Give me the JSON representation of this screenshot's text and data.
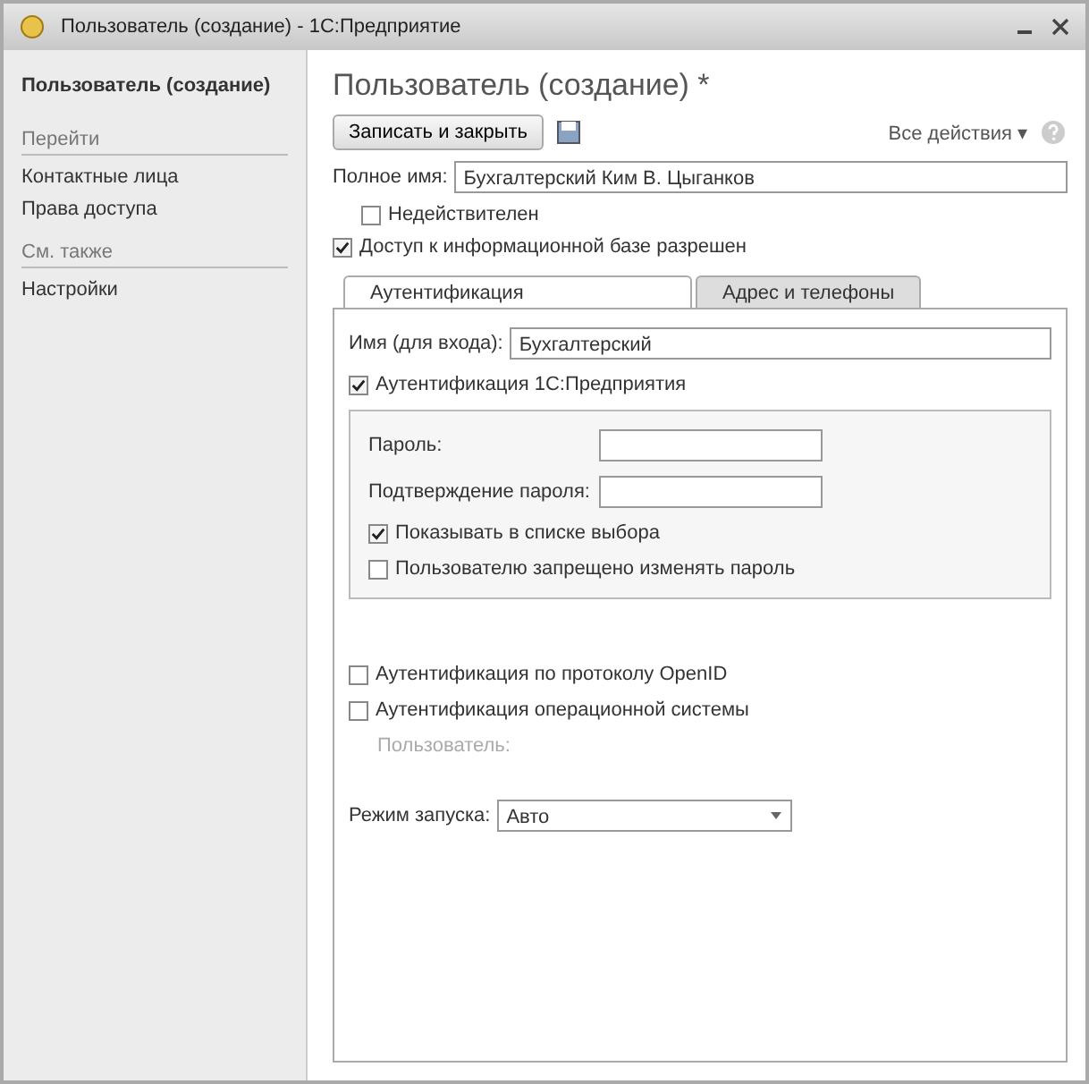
{
  "window": {
    "title": "Пользователь (создание) - 1С:Предприятие"
  },
  "sidebar": {
    "title": "Пользователь (создание)",
    "items": [
      {
        "kind": "header",
        "label": "Перейти"
      },
      {
        "kind": "link",
        "label": "Контактные лица"
      },
      {
        "kind": "link",
        "label": "Права доступа"
      },
      {
        "kind": "header",
        "label": "См. также"
      },
      {
        "kind": "link",
        "label": "Настройки"
      }
    ]
  },
  "form": {
    "title": "Пользователь (создание) *",
    "save_close_button": "Записать и закрыть",
    "all_actions": "Все действия ▾",
    "full_name": {
      "label": "Полное имя:",
      "value": "Бухгалтерский Ким В. Цыганков"
    },
    "inactive": {
      "label": "Недействителен",
      "checked": false
    },
    "access": {
      "label": "Доступ к информационной базе разрешен",
      "checked": true
    },
    "tabs": [
      {
        "label": "Аутентификация",
        "selected": true
      },
      {
        "label": "Адрес и телефоны",
        "selected": false
      }
    ],
    "login": {
      "label": "Имя (для входа):",
      "value": "Бухгалтерский"
    },
    "auth_1c": {
      "label": "Аутентификация 1С:Предприятия",
      "checked": true
    },
    "password": {
      "label": "Пароль:"
    },
    "password_confirm": {
      "label": "Подтверждение пароля:"
    },
    "show_in_list": {
      "label": "Показывать в списке выбора",
      "checked": true
    },
    "cannot_change": {
      "label": "Пользователю запрещено изменять пароль",
      "checked": false
    },
    "auth_openid": {
      "label": "Аутентификация по протоколу OpenID",
      "checked": false
    },
    "auth_os": {
      "label": "Аутентификация операционной системы",
      "checked": false
    },
    "os_user": {
      "label": "Пользователь:",
      "disabled": true
    },
    "run_mode": {
      "label": "Режим запуска:",
      "value": "Авто"
    }
  }
}
